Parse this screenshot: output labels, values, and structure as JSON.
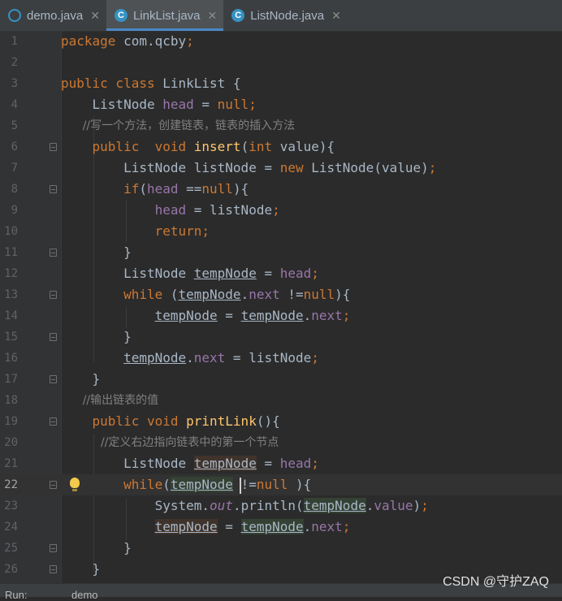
{
  "tabs": [
    {
      "label": "demo.java",
      "icon": "java-class-icon",
      "active": false
    },
    {
      "label": "LinkList.java",
      "icon": "java-class-icon",
      "active": true
    },
    {
      "label": "ListNode.java",
      "icon": "java-class-icon",
      "active": false
    }
  ],
  "editor": {
    "current_line": 22,
    "lines": [
      {
        "n": "1",
        "text": "package com.qcby;"
      },
      {
        "n": "2",
        "text": ""
      },
      {
        "n": "3",
        "text": "public class LinkList {"
      },
      {
        "n": "4",
        "text": "    ListNode head = null;"
      },
      {
        "n": "5",
        "text": "    //写一个方法，创建链表，链表的插入方法"
      },
      {
        "n": "6",
        "text": "    public  void insert(int value){"
      },
      {
        "n": "7",
        "text": "        ListNode listNode = new ListNode(value);"
      },
      {
        "n": "8",
        "text": "        if(head ==null){"
      },
      {
        "n": "9",
        "text": "            head = listNode;"
      },
      {
        "n": "10",
        "text": "            return;"
      },
      {
        "n": "11",
        "text": "        }"
      },
      {
        "n": "12",
        "text": "        ListNode tempNode = head;"
      },
      {
        "n": "13",
        "text": "        while (tempNode.next !=null){"
      },
      {
        "n": "14",
        "text": "            tempNode = tempNode.next;"
      },
      {
        "n": "15",
        "text": "        }"
      },
      {
        "n": "16",
        "text": "        tempNode.next = listNode;"
      },
      {
        "n": "17",
        "text": "    }"
      },
      {
        "n": "18",
        "text": "    //输出链表的值"
      },
      {
        "n": "19",
        "text": "    public void printLink(){"
      },
      {
        "n": "20",
        "text": "        //定义右边指向链表中的第一个节点"
      },
      {
        "n": "21",
        "text": "        ListNode tempNode = head;"
      },
      {
        "n": "22",
        "text": "        while(tempNode !=null ){"
      },
      {
        "n": "23",
        "text": "            System.out.println(tempNode.value);"
      },
      {
        "n": "24",
        "text": "            tempNode = tempNode.next;"
      },
      {
        "n": "25",
        "text": "        }"
      },
      {
        "n": "26",
        "text": "    }"
      }
    ]
  },
  "bottom_bar": {
    "run_label": "Run:",
    "config": "demo"
  },
  "watermark": "CSDN @守护ZAQ",
  "colors": {
    "background": "#2b2b2b",
    "keyword": "#cc7832",
    "method": "#ffc66d",
    "field": "#9876aa",
    "comment": "#808080",
    "text": "#a9b7c6",
    "accent": "#4a88c7"
  }
}
